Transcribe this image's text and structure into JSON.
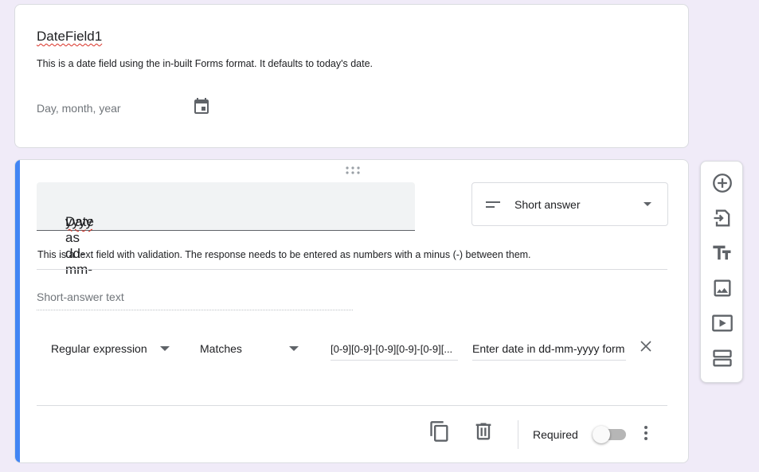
{
  "question1": {
    "title": "DateField1",
    "description": "This is a date field using the in-built Forms format.  It defaults to today's date.",
    "date_placeholder": "Day, month, year",
    "date_icon": "calendar-icon"
  },
  "question2": {
    "title": "Date as dd-mm-yyyy",
    "title_plain": "Date as dd-mm-",
    "title_spell": "yyyy",
    "type": "Short answer",
    "description": "This is a text field with validation. The response needs to be entered as numbers with a minus (-) between them.",
    "answer_placeholder": "Short-answer text",
    "validation": {
      "type": "Regular expression",
      "condition": "Matches",
      "pattern": "[0-9][0-9]-[0-9][0-9]-[0-9][...",
      "error_text": "Enter date in dd-mm-yyyy form"
    },
    "required_label": "Required",
    "required": false
  },
  "toolbar": {
    "items": [
      "add-question-icon",
      "import-questions-icon",
      "add-title-icon",
      "add-image-icon",
      "add-video-icon",
      "add-section-icon"
    ]
  },
  "colors": {
    "background": "#f0ebf8",
    "accent": "#4285f4",
    "icon": "#5f6368"
  }
}
